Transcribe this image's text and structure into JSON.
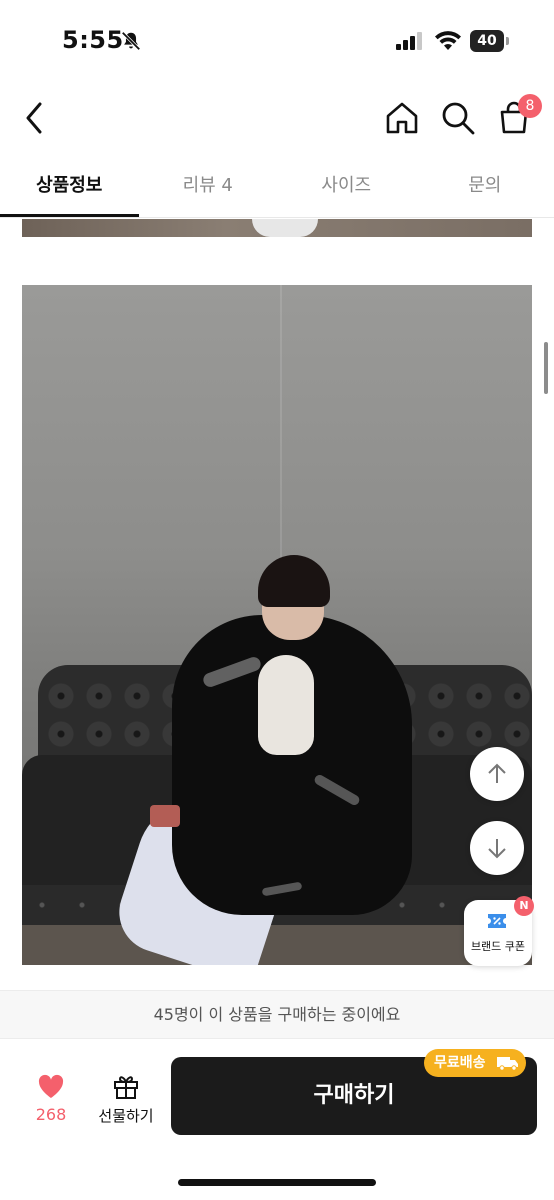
{
  "status_bar": {
    "time": "5:55",
    "battery": "40"
  },
  "header": {
    "cart_count": "8"
  },
  "tabs": [
    {
      "label": "상품정보",
      "active": true
    },
    {
      "label": "리뷰 4",
      "active": false
    },
    {
      "label": "사이즈",
      "active": false
    },
    {
      "label": "문의",
      "active": false
    }
  ],
  "floating": {
    "coupon_label": "브랜드 쿠폰",
    "coupon_badge": "N"
  },
  "notice": {
    "text": "45명이 이 상품을 구매하는 중이에요"
  },
  "bottom_bar": {
    "like_count": "268",
    "gift_label": "선물하기",
    "buy_label": "구매하기",
    "shipping_badge": "무료배송"
  },
  "colors": {
    "accent_pink": "#f4606c",
    "shipping_yellow": "#f6b11f",
    "buy_button": "#1b1b1b"
  },
  "icons": [
    "bell-off-icon",
    "signal-icon",
    "wifi-icon",
    "battery-icon",
    "back-arrow-icon",
    "home-icon",
    "search-icon",
    "cart-icon",
    "arrow-up-icon",
    "arrow-down-icon",
    "coupon-icon",
    "heart-icon",
    "gift-icon",
    "truck-icon"
  ]
}
